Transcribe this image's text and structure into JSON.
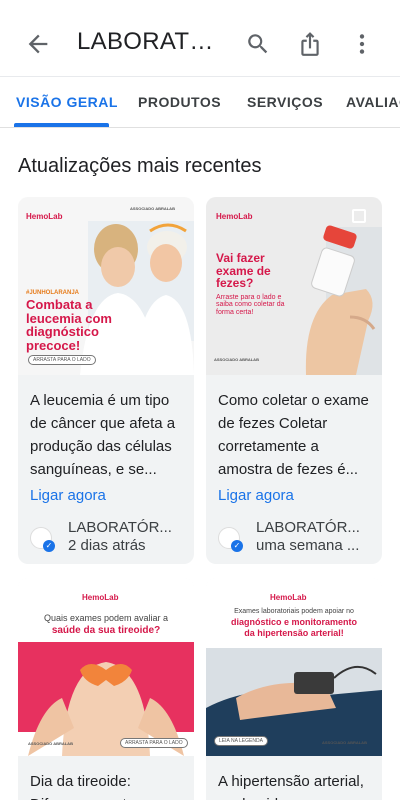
{
  "header": {
    "title": "LABORATÓRI...",
    "back_icon": "arrow-back-icon",
    "icons": [
      "search-icon",
      "share-icon",
      "more-vert-icon"
    ]
  },
  "tabs": [
    {
      "label": "VISÃO GERAL",
      "active": true
    },
    {
      "label": "PRODUTOS",
      "active": false
    },
    {
      "label": "SERVIÇOS",
      "active": false
    },
    {
      "label": "AVALIAÇ",
      "active": false
    }
  ],
  "section": {
    "title": "Atualizações mais recentes"
  },
  "colors": {
    "accent": "#1a73e8",
    "brand": "#d5184a"
  },
  "cards": [
    {
      "brand": "HemoLab",
      "assoc": "ASSOCIADO ABRALAB",
      "tag": "#JUNHOLARANJA",
      "headline": "Combata a leucemia com diagnóstico precoce!",
      "pill": "ARRASTA PARA O LADO",
      "description": "A leucemia é um tipo de câncer que afeta a produção das células sanguíneas, e se...",
      "cta": "Ligar agora",
      "author": "LABORATÓR...",
      "time": "2 dias atrás"
    },
    {
      "brand": "HemoLab",
      "assoc": "ASSOCIADO ABRALAB",
      "headline": "Vai fazer exame de fezes?",
      "subline": "Arraste para o lado e saiba como coletar da forma certa!",
      "description": "Como coletar o exame de fezes Coletar corretamente a amostra de fezes é...",
      "cta": "Ligar agora",
      "author": "LABORATÓR...",
      "time": "uma semana ..."
    },
    {
      "brand": "HemoLab",
      "assoc": "ASSOCIADO ABRALAB",
      "headline_top": "Quais exames podem avaliar a",
      "headline_bottom": "saúde da sua tireoide?",
      "pill": "ARRASTA PARA O LADO",
      "description": "Dia da tireoide: Diferenças entre os..."
    },
    {
      "brand": "HemoLab",
      "assoc": "ASSOCIADO ABRALAB",
      "headline_top": "Exames laboratoriais podem apoiar no",
      "headline_mid": "diagnóstico e monitoramento",
      "headline_bottom": "da hipertensão arterial!",
      "pill": "LEIA NA LEGENDA",
      "description": "A hipertensão arterial, conhecida como..."
    }
  ]
}
